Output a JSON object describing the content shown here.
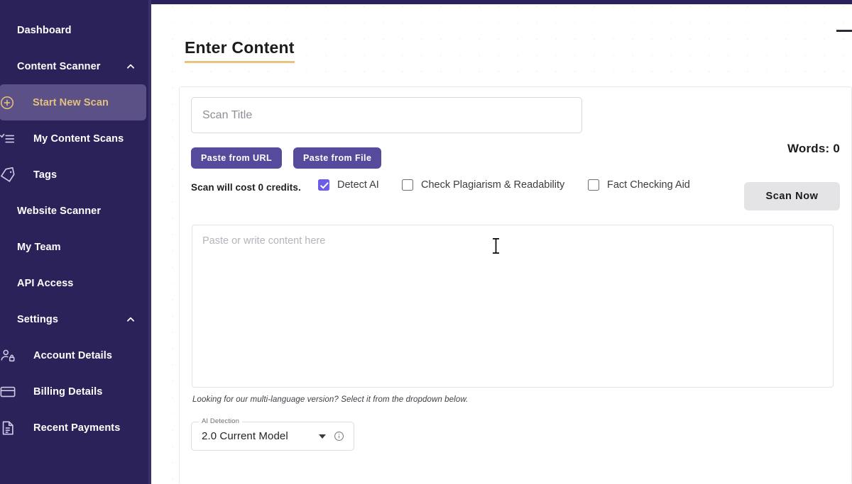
{
  "colors": {
    "sidebar_bg": "#2b2259",
    "sidebar_active_bg": "#5b5186",
    "accent_gold": "#e3c07e",
    "button_purple": "#554a9c",
    "checkbox_checked": "#6c5ce7",
    "scan_button_bg": "#e4e4e6",
    "title_underline": "#e8c37e"
  },
  "sidebar": {
    "items": [
      {
        "label": "Dashboard",
        "icon": "none",
        "level": "top",
        "active": false,
        "chevron": "none"
      },
      {
        "label": "Content Scanner",
        "icon": "none",
        "level": "top",
        "active": false,
        "chevron": "chevron-up-icon"
      },
      {
        "label": "Start New Scan",
        "icon": "plus-circle-icon",
        "level": "child",
        "active": true,
        "chevron": "none"
      },
      {
        "label": "My Content Scans",
        "icon": "list-check-icon",
        "level": "child",
        "active": false,
        "chevron": "none"
      },
      {
        "label": "Tags",
        "icon": "tag-icon",
        "level": "child",
        "active": false,
        "chevron": "none"
      },
      {
        "label": "Website Scanner",
        "icon": "none",
        "level": "top",
        "active": false,
        "chevron": "none"
      },
      {
        "label": "My Team",
        "icon": "none",
        "level": "top",
        "active": false,
        "chevron": "none"
      },
      {
        "label": "API Access",
        "icon": "none",
        "level": "top",
        "active": false,
        "chevron": "none"
      },
      {
        "label": "Settings",
        "icon": "none",
        "level": "top",
        "active": false,
        "chevron": "chevron-up-icon"
      },
      {
        "label": "Account Details",
        "icon": "user-lock-icon",
        "level": "child",
        "active": false,
        "chevron": "none"
      },
      {
        "label": "Billing Details",
        "icon": "credit-card-icon",
        "level": "child",
        "active": false,
        "chevron": "none"
      },
      {
        "label": "Recent Payments",
        "icon": "document-icon",
        "level": "child",
        "active": false,
        "chevron": "none"
      }
    ]
  },
  "main": {
    "page_title": "Enter Content",
    "scan_title": {
      "value": "",
      "placeholder": "Scan Title"
    },
    "buttons": {
      "paste_from_url": "Paste from URL",
      "paste_from_file": "Paste from File",
      "scan_now": "Scan Now"
    },
    "credit_note": "Scan will cost 0 credits.",
    "checkboxes": [
      {
        "label": "Detect AI",
        "checked": true
      },
      {
        "label": "Check Plagiarism & Readability",
        "checked": false
      },
      {
        "label": "Fact Checking Aid",
        "checked": false
      }
    ],
    "words_count_label": "Words: 0",
    "content": {
      "value": "",
      "placeholder": "Paste or write content here"
    },
    "multilang_note": "Looking for our multi-language version? Select it from the dropdown below.",
    "model_select": {
      "legend": "AI Detection",
      "value": "2.0 Current Model",
      "caret_icon": "chevron-down-icon",
      "info_icon": "info-circle-icon"
    }
  }
}
